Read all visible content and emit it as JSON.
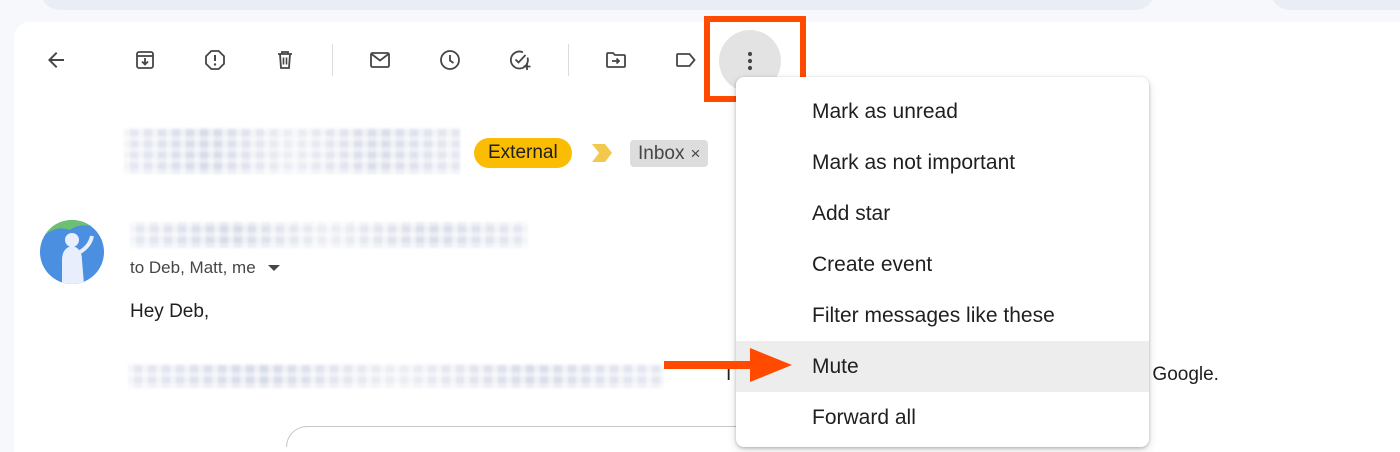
{
  "toolbar": {
    "buttons": [
      {
        "icon": "back-arrow-icon"
      },
      {
        "icon": "archive-icon"
      },
      {
        "icon": "report-spam-icon"
      },
      {
        "icon": "delete-icon"
      },
      {
        "icon": "mark-unread-icon"
      },
      {
        "icon": "snooze-icon"
      },
      {
        "icon": "add-to-tasks-icon"
      },
      {
        "icon": "move-to-icon"
      },
      {
        "icon": "label-icon"
      },
      {
        "icon": "more-options-icon"
      }
    ]
  },
  "email": {
    "labels": {
      "external": "External",
      "inbox": "Inbox",
      "inbox_remove": "×"
    },
    "recipients": "to Deb, Matt, me",
    "greeting": "Hey Deb,",
    "body_fragment_mid": "I",
    "body_fragment_end": "on Google."
  },
  "menu": {
    "items": [
      {
        "label": "Mark as unread",
        "active": false
      },
      {
        "label": "Mark as not important",
        "active": false
      },
      {
        "label": "Add star",
        "active": false
      },
      {
        "label": "Create event",
        "active": false
      },
      {
        "label": "Filter messages like these",
        "active": false
      },
      {
        "label": "Mute",
        "active": true
      },
      {
        "label": "Forward all",
        "active": false
      }
    ]
  },
  "colors": {
    "annotation": "#ff4a00",
    "external_chip": "#fbbc04",
    "importance_marker": "#f2c94c",
    "menu_highlight": "#ededed"
  }
}
